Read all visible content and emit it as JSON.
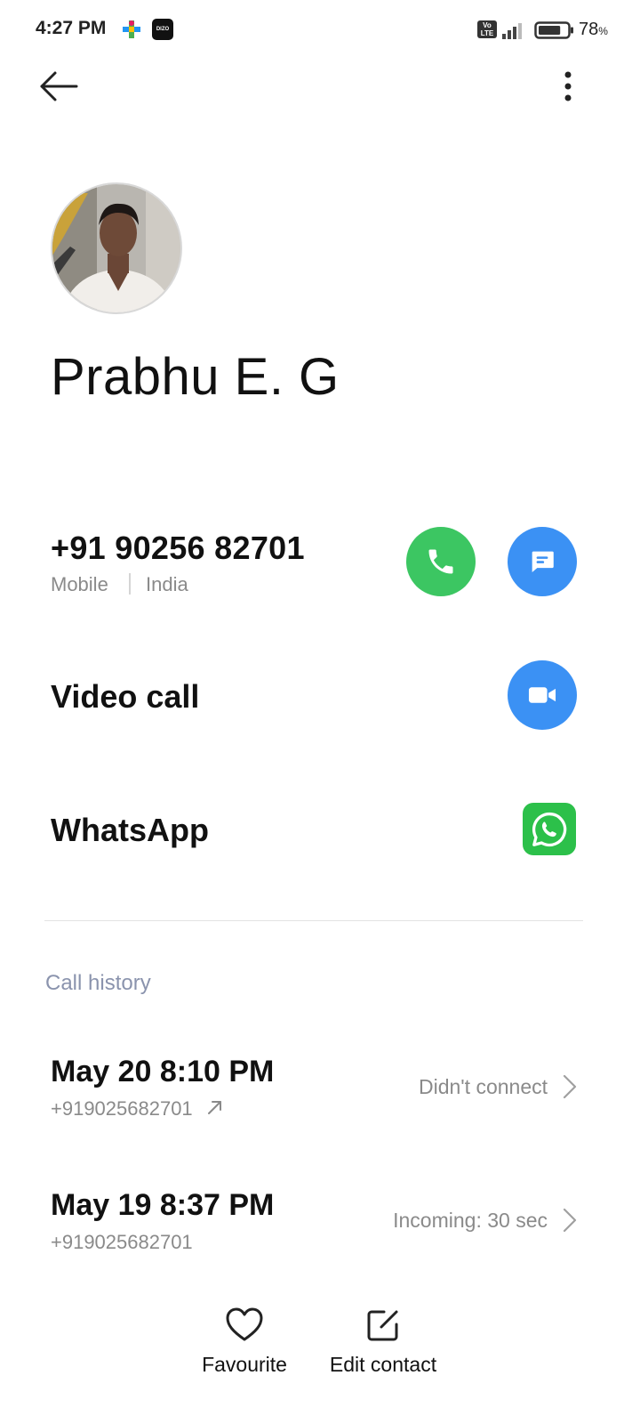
{
  "status_bar": {
    "time": "4:27 PM",
    "app_icon_2_text": "DIZO",
    "volte_text": "Vo LTE",
    "battery_percent": "78",
    "battery_unit": "%",
    "battery_level": 0.78
  },
  "top_bar": {
    "back_icon": "arrow-left-icon",
    "more_icon": "more-vertical-icon"
  },
  "contact": {
    "name": "Prabhu E. G",
    "phone": {
      "number": "+91 90256 82701",
      "type": "Mobile",
      "country": "India"
    },
    "video_call_label": "Video call",
    "whatsapp_label": "WhatsApp"
  },
  "colors": {
    "call_green": "#3cc662",
    "action_blue": "#3b91f4",
    "whatsapp_green": "#2cc04a",
    "section_title": "#8a93ad"
  },
  "call_history": {
    "title": "Call history",
    "entries": [
      {
        "date": "May 20 8:10 PM",
        "number": "+919025682701",
        "direction_icon": "outgoing-arrow-icon",
        "status": "Didn't connect"
      },
      {
        "date": "May 19 8:37 PM",
        "number": "+919025682701",
        "status": "Incoming: 30 sec"
      }
    ]
  },
  "bottom_actions": {
    "favourite_label": "Favourite",
    "edit_label": "Edit contact"
  }
}
